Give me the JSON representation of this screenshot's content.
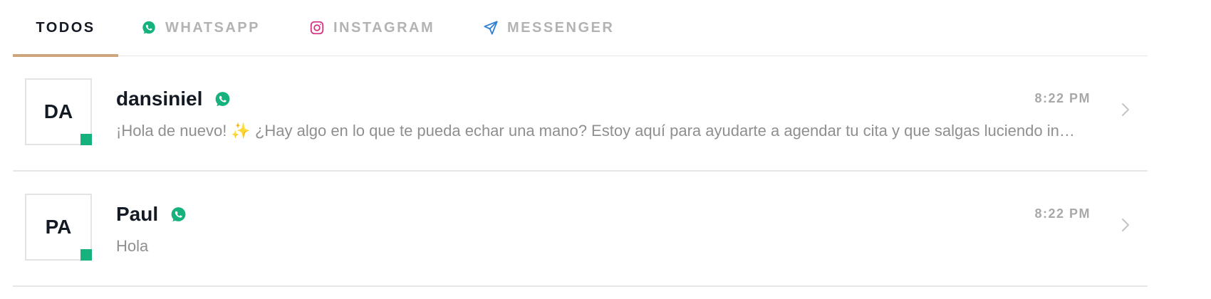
{
  "tabs": [
    {
      "label": "TODOS",
      "icon": "none",
      "active": true
    },
    {
      "label": "WHATSAPP",
      "icon": "whatsapp-icon",
      "active": false
    },
    {
      "label": "INSTAGRAM",
      "icon": "instagram-icon",
      "active": false
    },
    {
      "label": "MESSENGER",
      "icon": "send-icon",
      "active": false
    }
  ],
  "conversations": [
    {
      "initials": "DA",
      "name": "dansiniel",
      "channel_icon": "whatsapp-icon",
      "time": "8:22 PM",
      "preview": "¡Hola de nuevo! ✨ ¿Hay algo en lo que te pueda echar una mano? Estoy aquí para ayudarte a agendar tu cita y que salgas luciendo increíble"
    },
    {
      "initials": "PA",
      "name": "Paul",
      "channel_icon": "whatsapp-icon",
      "time": "8:22 PM",
      "preview": "Hola"
    }
  ],
  "colors": {
    "accent_underline": "#cfa57d",
    "whatsapp_green": "#16b27d",
    "instagram_pink": "#d63384",
    "messenger_blue": "#2f7fd6",
    "online_status": "#16b27d",
    "text_primary": "#141a24",
    "text_muted": "#b3b3b3"
  }
}
